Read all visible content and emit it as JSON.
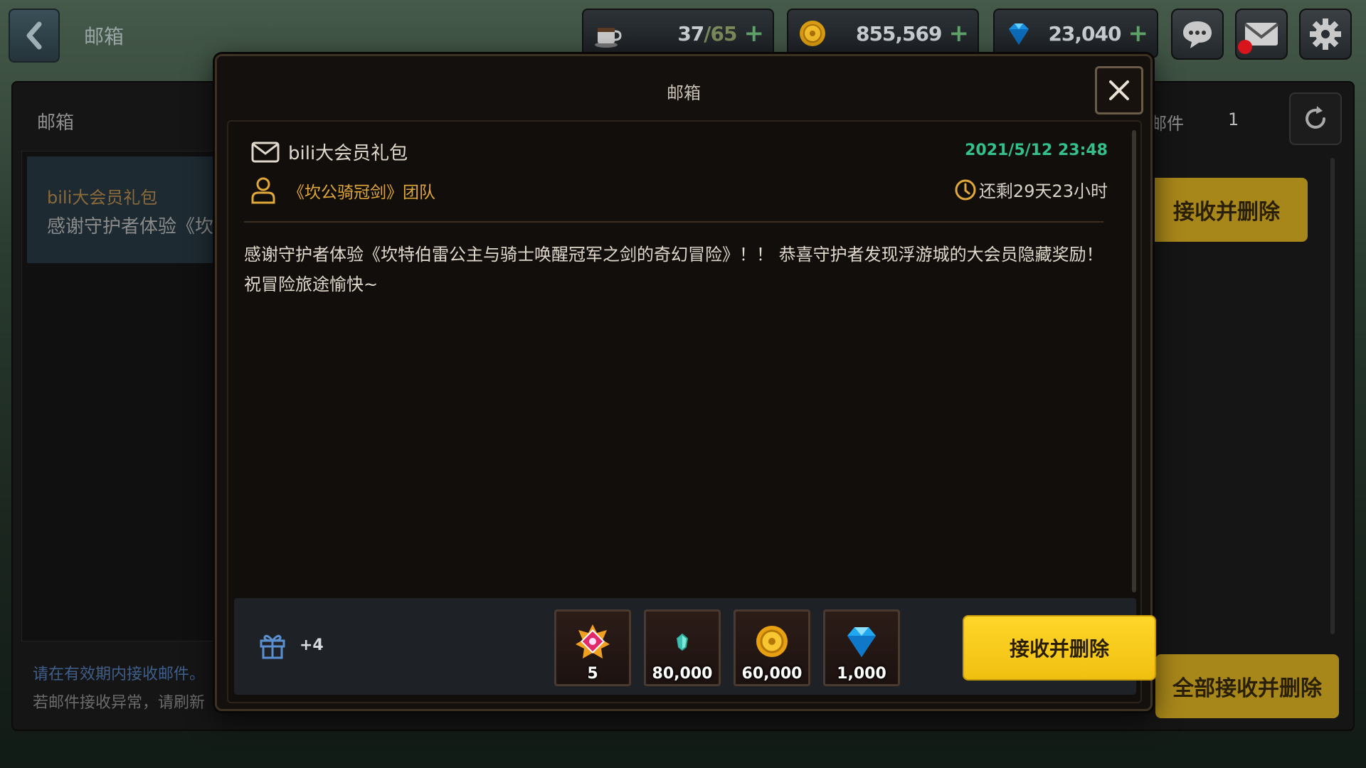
{
  "topbar": {
    "title": "邮箱",
    "stamina": {
      "current": "37",
      "max": "/65"
    },
    "gold": "855,569",
    "gems": "23,040",
    "plus": "+"
  },
  "background_panel": {
    "title": "邮箱",
    "list_item": {
      "title": "bili大会员礼包",
      "preview": "感谢守护者体验《坎特伯雷"
    },
    "count_label": "邮件",
    "count_value": "1",
    "claim_label": "接收并删除",
    "claim_all_label": "全部接收并删除",
    "note_line1": "请在有效期内接收邮件。",
    "note_line2": "若邮件接收异常，请刷新"
  },
  "modal": {
    "title": "邮箱",
    "mail_title": "bili大会员礼包",
    "date": "2021/5/12 23:48",
    "sender": "《坎公骑冠剑》团队",
    "remaining": "还剩29天23小时",
    "body": "感谢守护者体验《坎特伯雷公主与骑士唤醒冠军之剑的奇幻冒险》！！ 恭喜守护者发现浮游城的大会员隐藏奖励！祝冒险旅途愉快~",
    "gift_count": "+4",
    "rewards": [
      {
        "icon": "summon-ticket-icon",
        "qty": "5"
      },
      {
        "icon": "crystal-shard-icon",
        "qty": "80,000"
      },
      {
        "icon": "gold-coin-icon",
        "qty": "60,000"
      },
      {
        "icon": "blue-gem-icon",
        "qty": "1,000"
      }
    ],
    "claim_label": "接收并删除"
  },
  "colors": {
    "accent_yellow": "#f5c518",
    "date_green": "#33c08a",
    "sender_orange": "#e0a838"
  }
}
